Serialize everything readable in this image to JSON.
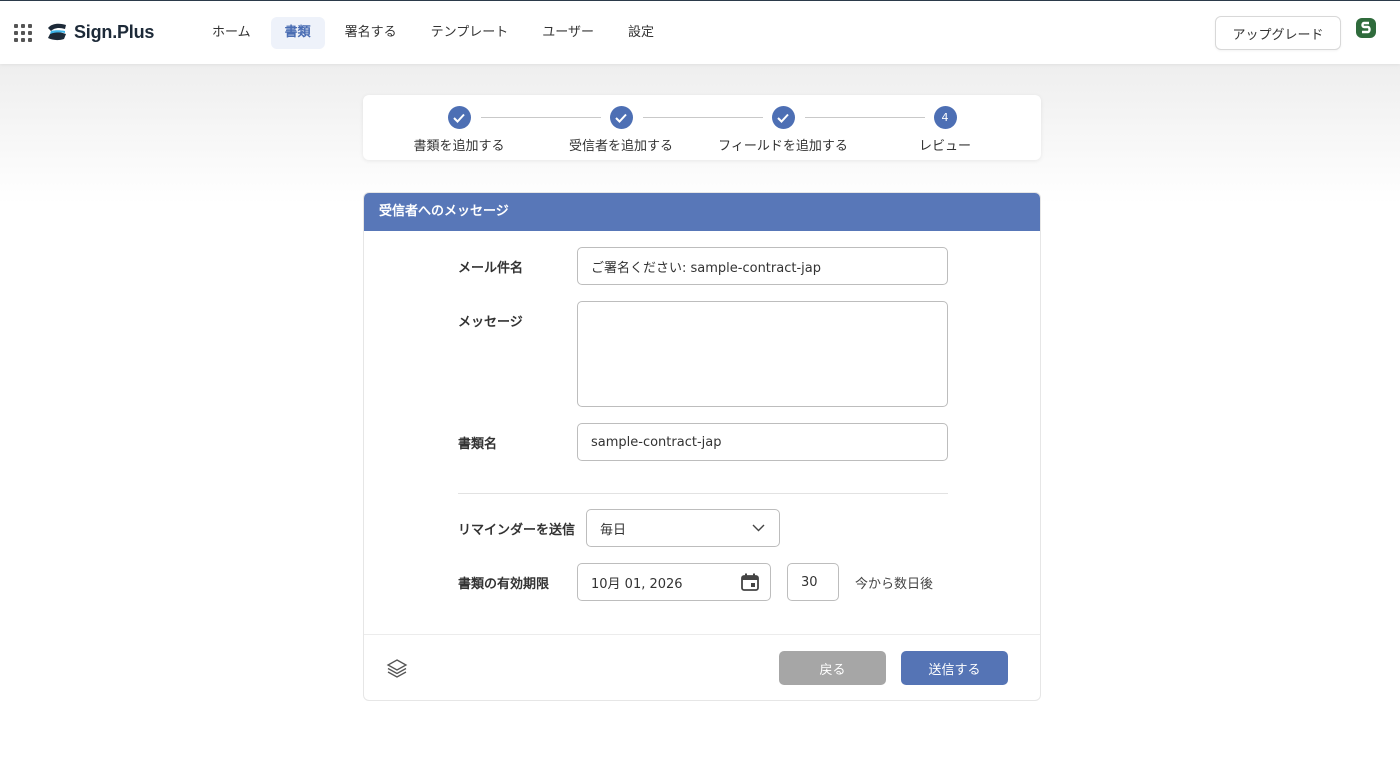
{
  "app": {
    "logo_text": "Sign.Plus"
  },
  "nav": {
    "items": [
      {
        "label": "ホーム"
      },
      {
        "label": "書類"
      },
      {
        "label": "署名する"
      },
      {
        "label": "テンプレート"
      },
      {
        "label": "ユーザー"
      },
      {
        "label": "設定"
      }
    ],
    "active": "書類"
  },
  "header": {
    "upgrade_label": "アップグレード",
    "avatar_icon": "user-avatar-icon"
  },
  "stepper": {
    "steps": [
      {
        "label": "書類を追加する",
        "state": "done"
      },
      {
        "label": "受信者を追加する",
        "state": "done"
      },
      {
        "label": "フィールドを追加する",
        "state": "done"
      },
      {
        "label": "レビュー",
        "state": "current",
        "number": "4"
      }
    ]
  },
  "form": {
    "title": "受信者へのメッセージ",
    "subject_label": "メール件名",
    "subject_value": "ご署名ください: sample-contract-jap",
    "message_label": "メッセージ",
    "message_value": "",
    "doc_name_label": "書類名",
    "doc_name_value": "sample-contract-jap",
    "reminder_label": "リマインダーを送信",
    "reminder_value": "毎日",
    "expiry_label": "書類の有効期限",
    "expiry_date": "10月 01, 2026",
    "expiry_days": "30",
    "expiry_suffix": "今から数日後"
  },
  "footer": {
    "back_label": "戻る",
    "send_label": "送信する"
  },
  "colors": {
    "accent": "#5877b8",
    "step_done": "#4d6fb4",
    "back_button": "#a6a6a6"
  }
}
